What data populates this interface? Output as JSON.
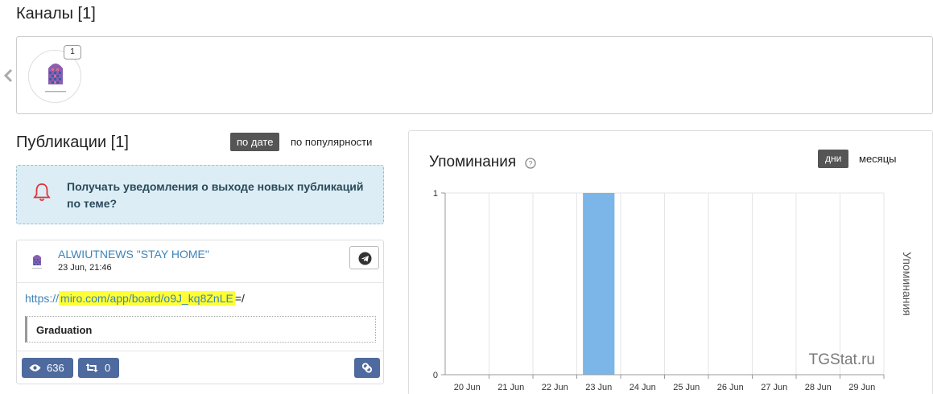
{
  "channels": {
    "title": "Каналы [1]",
    "items": [
      {
        "count": "1",
        "icon": "channel-logo"
      }
    ]
  },
  "publications": {
    "title": "Публикации [1]",
    "sort_by_date": "по дате",
    "sort_by_popularity": "по популярности",
    "notify_text": "Получать уведомления о выходе новых публикаций по теме?",
    "post": {
      "channel": "ALWIUTNEWS \"STAY HOME\"",
      "date": "23 Jun, 21:46",
      "link_prefix": "https://",
      "link_highlight": "miro.com/app/board/o9J_kq8ZnLE",
      "link_suffix": "=/",
      "quote": "Graduation",
      "views": "636",
      "reposts": "0"
    }
  },
  "mentions": {
    "title": "Упоминания",
    "period_days": "дни",
    "period_months": "месяцы",
    "watermark": "TGStat.ru",
    "accent_color": "#7cb5e8"
  },
  "chart_data": {
    "type": "bar",
    "categories": [
      "20 Jun",
      "21 Jun",
      "22 Jun",
      "23 Jun",
      "24 Jun",
      "25 Jun",
      "26 Jun",
      "27 Jun",
      "28 Jun",
      "29 Jun"
    ],
    "values": [
      0,
      0,
      0,
      1,
      0,
      0,
      0,
      0,
      0,
      0
    ],
    "ylim": [
      0,
      1
    ],
    "yticks": [
      "0",
      "1"
    ],
    "ylabel": "Упоминания",
    "grid": true
  }
}
